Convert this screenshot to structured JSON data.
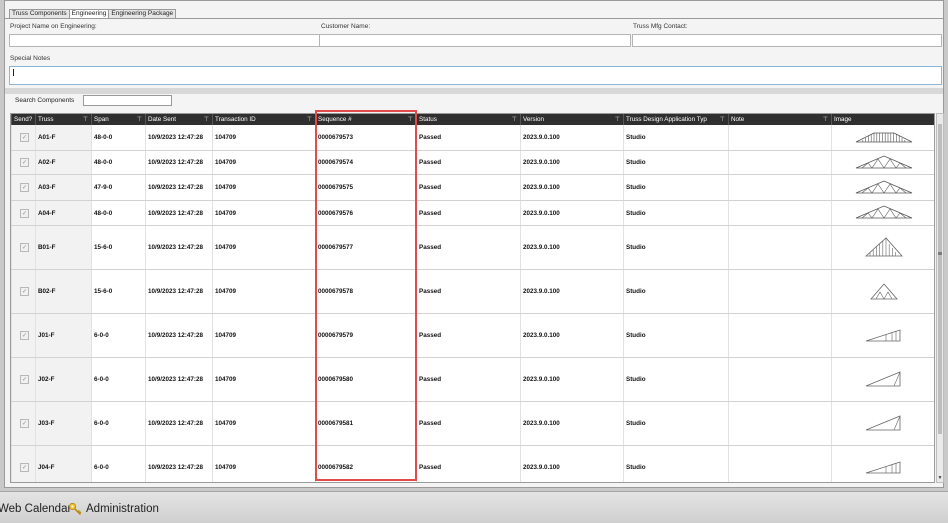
{
  "tabs": [
    "Truss Components",
    "Engineering",
    "Engineering Package"
  ],
  "active_tab": 1,
  "form": {
    "project_name_label": "Project Name on Engineering:",
    "customer_name_label": "Customer Name:",
    "mfg_contact_label": "Truss Mfg Contact:",
    "special_notes_label": "Special Notes",
    "project_name_value": "",
    "customer_name_value": "",
    "mfg_contact_value": "",
    "special_notes_value": ""
  },
  "search": {
    "label": "Search Components",
    "value": ""
  },
  "grid": {
    "columns": [
      "Send?",
      "Truss",
      "Span",
      "Date Sent",
      "Transaction ID",
      "Sequence #",
      "Status",
      "Version",
      "Truss Design Application Typ",
      "Note",
      "Image"
    ],
    "rows": [
      {
        "truss": "A01-F",
        "span": "48-0-0",
        "date": "10/9/2023 12:47:28",
        "txn": "104709",
        "seq": "0000679573",
        "status": "Passed",
        "version": "2023.9.0.100",
        "app": "Studio",
        "note": "",
        "image": "flat-truss-icon"
      },
      {
        "truss": "A02-F",
        "span": "48-0-0",
        "date": "10/9/2023 12:47:28",
        "txn": "104709",
        "seq": "0000679574",
        "status": "Passed",
        "version": "2023.9.0.100",
        "app": "Studio",
        "note": "",
        "image": "gable-truss-icon"
      },
      {
        "truss": "A03-F",
        "span": "47-9-0",
        "date": "10/9/2023 12:47:28",
        "txn": "104709",
        "seq": "0000679575",
        "status": "Passed",
        "version": "2023.9.0.100",
        "app": "Studio",
        "note": "",
        "image": "gable-truss-icon"
      },
      {
        "truss": "A04-F",
        "span": "48-0-0",
        "date": "10/9/2023 12:47:28",
        "txn": "104709",
        "seq": "0000679576",
        "status": "Passed",
        "version": "2023.9.0.100",
        "app": "Studio",
        "note": "",
        "image": "gable-truss-icon"
      },
      {
        "truss": "B01-F",
        "span": "15-6-0",
        "date": "10/9/2023 12:47:28",
        "txn": "104709",
        "seq": "0000679577",
        "status": "Passed",
        "version": "2023.9.0.100",
        "app": "Studio",
        "note": "",
        "image": "vertical-web-truss-icon"
      },
      {
        "truss": "B02-F",
        "span": "15-6-0",
        "date": "10/9/2023 12:47:28",
        "txn": "104709",
        "seq": "0000679578",
        "status": "Passed",
        "version": "2023.9.0.100",
        "app": "Studio",
        "note": "",
        "image": "small-gable-truss-icon"
      },
      {
        "truss": "J01-F",
        "span": "6-0-0",
        "date": "10/9/2023 12:47:28",
        "txn": "104709",
        "seq": "0000679579",
        "status": "Passed",
        "version": "2023.9.0.100",
        "app": "Studio",
        "note": "",
        "image": "jack-truss-icon"
      },
      {
        "truss": "J02-F",
        "span": "6-0-0",
        "date": "10/9/2023 12:47:28",
        "txn": "104709",
        "seq": "0000679580",
        "status": "Passed",
        "version": "2023.9.0.100",
        "app": "Studio",
        "note": "",
        "image": "mono-truss-icon"
      },
      {
        "truss": "J03-F",
        "span": "6-0-0",
        "date": "10/9/2023 12:47:28",
        "txn": "104709",
        "seq": "0000679581",
        "status": "Passed",
        "version": "2023.9.0.100",
        "app": "Studio",
        "note": "",
        "image": "mono-truss-icon"
      },
      {
        "truss": "J04-F",
        "span": "6-0-0",
        "date": "10/9/2023 12:47:28",
        "txn": "104709",
        "seq": "0000679582",
        "status": "Passed",
        "version": "2023.9.0.100",
        "app": "Studio",
        "note": "",
        "image": "jack-truss-icon"
      }
    ]
  },
  "footer": {
    "web_calendar": "Web Calendar",
    "administration": "Administration"
  },
  "colors": {
    "header_bg": "#2f2f2f",
    "highlight": "#e14b4b",
    "panel_bg": "#f4f4f4"
  }
}
